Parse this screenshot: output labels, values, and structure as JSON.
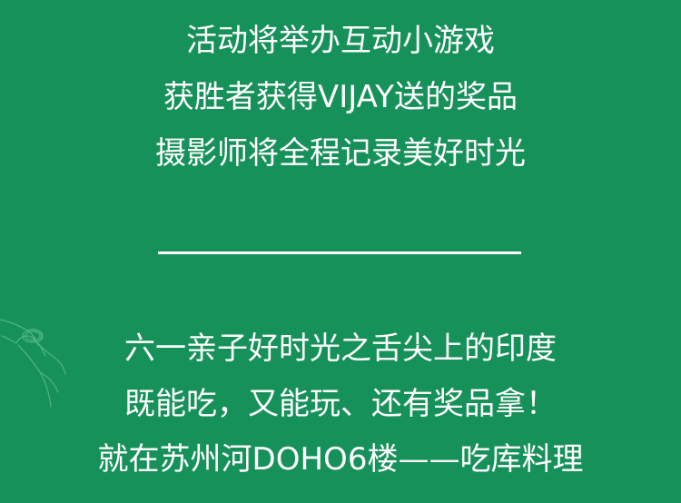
{
  "intro_lines": [
    "活动将举办互动小游戏",
    "获胜者获得VIJAY送的奖品",
    "摄影师将全程记录美好时光"
  ],
  "event_lines": [
    "六一亲子好时光之舌尖上的印度",
    "既能吃，又能玩、还有奖品拿！",
    "就在苏州河DOHO6楼——吃库料理"
  ],
  "colors": {
    "background": "#17915a",
    "text": "#ffffff",
    "decoration": "#5fbf8c"
  },
  "icons": {
    "decoration": "hand-illustration"
  }
}
